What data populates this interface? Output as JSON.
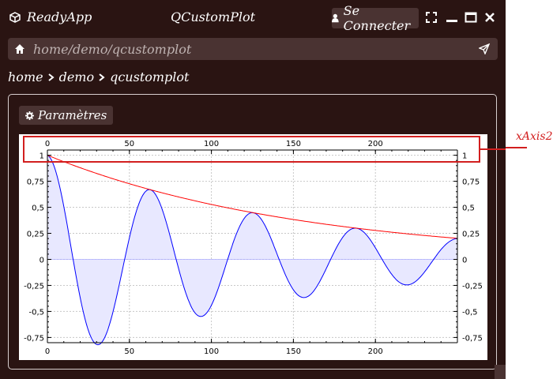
{
  "app": {
    "name": "ReadyApp",
    "window_title": "QCustomPlot",
    "connect_label": "Se Connecter"
  },
  "address": {
    "url": "home/demo/qcustomplot"
  },
  "breadcrumb": {
    "items": [
      "home",
      "demo",
      "qcustomplot"
    ]
  },
  "panel": {
    "settings_label": "Paramètres"
  },
  "annotation": {
    "label": "xAxis2"
  },
  "colors": {
    "background": "#2a1412",
    "control": "#4a3332",
    "highlight": "#d21f1f",
    "curve": "#0000ff",
    "envelope": "#ff0000"
  },
  "chart_data": {
    "type": "line",
    "title": "",
    "xlabel": "",
    "ylabel": "",
    "xlim": [
      0,
      250
    ],
    "ylim": [
      -0.8,
      1.05
    ],
    "x_ticks": [
      0,
      50,
      100,
      150,
      200
    ],
    "x2_ticks": [
      0,
      50,
      100,
      150,
      200
    ],
    "y_ticks": [
      1,
      0.75,
      0.5,
      0.25,
      0,
      -0.25,
      -0.5,
      -0.75
    ],
    "y_tick_labels": [
      "1",
      "0,75",
      "0,5",
      "0,25",
      "0",
      "-0,25",
      "-0,5",
      "-0,75"
    ],
    "grid": true,
    "series": [
      {
        "color": "#0000ff",
        "fill": "#e8e8ff",
        "function": "damped_cosine",
        "decay": 0.0064,
        "period": 62.8,
        "points": [
          [
            0,
            1
          ],
          [
            31,
            -0.8
          ],
          [
            62,
            0.66
          ],
          [
            94,
            -0.53
          ],
          [
            125,
            0.44
          ],
          [
            157,
            -0.35
          ],
          [
            188,
            0.29
          ],
          [
            220,
            -0.22
          ],
          [
            249,
            0.19
          ]
        ]
      },
      {
        "color": "#ff0000",
        "function": "envelope",
        "decay": 0.0064,
        "points": [
          [
            0,
            1
          ],
          [
            62,
            0.66
          ],
          [
            125,
            0.44
          ],
          [
            188,
            0.29
          ],
          [
            249,
            0.19
          ]
        ]
      }
    ]
  }
}
